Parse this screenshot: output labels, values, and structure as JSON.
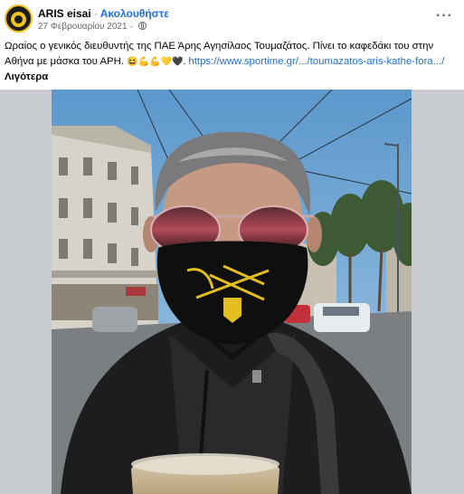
{
  "post": {
    "page_name": "ARIS eisai",
    "follow_label": "Ακολουθήστε",
    "separator": "·",
    "date": "27 Φεβρουαρίου 2021",
    "more_label": "···",
    "avatar_icon": "page-avatar-icon",
    "privacy_icon": "globe-icon",
    "caption": {
      "text": "Ωραίος ο γενικός διευθυντής της ΠΑΕ Άρης Αγησίλαος Τουμαζάτος. Πίνει το καφεδάκι του στην Αθήνα με μάσκα του ΑΡΗ.",
      "emojis": "😆💪💪💛🖤.",
      "link": "https://www.sportime.gr/.../toumazatos-aris-kathe-fora.../",
      "see_more": "Λιγότερα"
    },
    "photo_alt": "selfie-photo"
  },
  "colors": {
    "accent": "#216fdb",
    "secondary_text": "#65676b",
    "frame_background": "#c9ccd1",
    "aris_yellow": "#f2c318"
  }
}
